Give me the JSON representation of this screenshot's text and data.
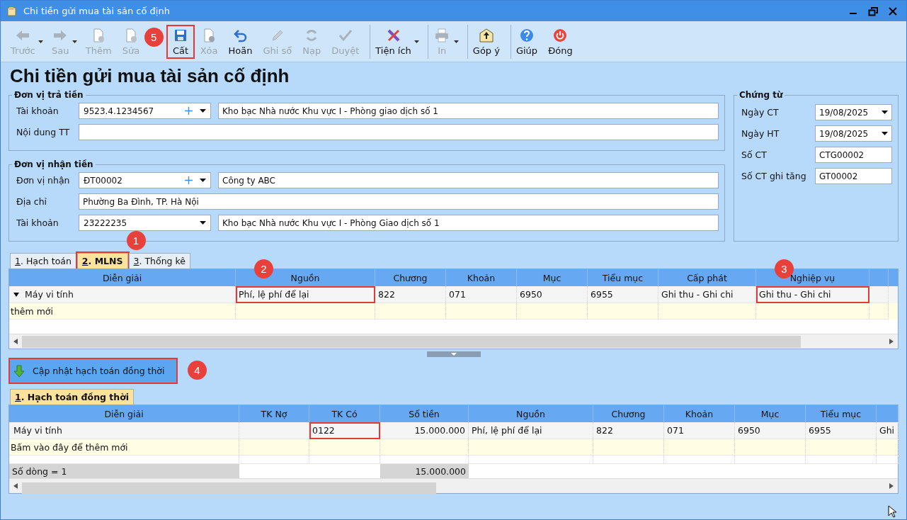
{
  "window": {
    "title": "Chi tiền gửi mua tài sản cố định"
  },
  "toolbar": [
    {
      "label": "Trước",
      "disabled": true,
      "dropdown": true,
      "separator_before": false,
      "highlighted": false
    },
    {
      "label": "Sau",
      "disabled": true,
      "dropdown": true,
      "separator_before": false,
      "highlighted": false
    },
    {
      "label": "Thêm",
      "disabled": true,
      "dropdown": false,
      "separator_before": false,
      "highlighted": false
    },
    {
      "label": "Sửa",
      "disabled": true,
      "dropdown": false,
      "separator_before": false,
      "highlighted": false
    },
    {
      "label": "Cất",
      "disabled": false,
      "dropdown": false,
      "separator_before": false,
      "highlighted": true,
      "callout": "5"
    },
    {
      "label": "Xóa",
      "disabled": true,
      "dropdown": false,
      "separator_before": false,
      "highlighted": false
    },
    {
      "label": "Hoãn",
      "disabled": false,
      "dropdown": false,
      "separator_before": false,
      "highlighted": false
    },
    {
      "label": "Ghi sổ",
      "disabled": true,
      "dropdown": false,
      "separator_before": false,
      "highlighted": false
    },
    {
      "label": "Nạp",
      "disabled": true,
      "dropdown": false,
      "separator_before": false,
      "highlighted": false
    },
    {
      "label": "Duyệt",
      "disabled": true,
      "dropdown": false,
      "separator_before": false,
      "highlighted": false
    },
    {
      "label": "Tiện ích",
      "disabled": false,
      "dropdown": true,
      "separator_before": true,
      "highlighted": false
    },
    {
      "label": "In",
      "disabled": true,
      "dropdown": true,
      "separator_before": true,
      "highlighted": false
    },
    {
      "label": "Góp ý",
      "disabled": false,
      "dropdown": false,
      "separator_before": true,
      "highlighted": false
    },
    {
      "label": "Giúp",
      "disabled": false,
      "dropdown": false,
      "separator_before": true,
      "highlighted": false
    },
    {
      "label": "Đóng",
      "disabled": false,
      "dropdown": false,
      "separator_before": false,
      "highlighted": false
    }
  ],
  "heading": "Chi tiền gửi mua tài sản cố định",
  "payer": {
    "legend": "Đơn vị trả tiền",
    "fields": [
      {
        "label": "Tài khoản",
        "kind": "account",
        "value": "9523.4.1234567",
        "add": true,
        "name": "Kho bạc Nhà nước Khu vực I - Phòng giao dịch số 1"
      },
      {
        "label": "Nội dung TT",
        "kind": "text"
      }
    ]
  },
  "payee": {
    "legend": "Đơn vị nhận tiền",
    "fields": [
      {
        "label": "Đơn vị nhận",
        "kind": "account",
        "value": "ĐT00002",
        "add": true,
        "name": "Công ty ABC"
      },
      {
        "label": "Địa chỉ",
        "kind": "text",
        "value": "Phường Ba Đình, TP. Hà Nội"
      },
      {
        "label": "Tài khoản",
        "kind": "account",
        "value": "23222235",
        "add": false,
        "name": "Kho bạc Nhà nước Khu vực I - Phòng Giao dịch số 1"
      }
    ]
  },
  "voucher": {
    "legend": "Chứng từ",
    "fields": [
      {
        "label": "Ngày CT",
        "kind": "date",
        "value": "19/08/2025"
      },
      {
        "label": "Ngày HT",
        "kind": "date",
        "value": "19/08/2025"
      },
      {
        "label": "Số CT",
        "kind": "text",
        "value": "CTG00002"
      },
      {
        "label": "Số CT ghi tăng",
        "kind": "text",
        "value": "GT00002"
      }
    ]
  },
  "tabs": [
    {
      "hotkey": "1",
      "label": ". Hạch toán",
      "selected": false,
      "highlighted": false
    },
    {
      "hotkey": "2",
      "label": ". MLNS",
      "selected": true,
      "highlighted": true,
      "callout": "1"
    },
    {
      "hotkey": "3",
      "label": ". Thống kê",
      "selected": false,
      "highlighted": false
    }
  ],
  "grid": {
    "columns": [
      {
        "label": "Diễn giải"
      },
      {
        "label": "Nguồn",
        "callout": "2"
      },
      {
        "label": "Chương"
      },
      {
        "label": "Khoản"
      },
      {
        "label": "Mục"
      },
      {
        "label": "Tiểu mục"
      },
      {
        "label": "Cấp phát"
      },
      {
        "label": "Nghiệp vụ",
        "callout": "3"
      },
      {}
    ],
    "rows": [
      {
        "current": true,
        "cells": [
          {
            "text": "Máy vi tính",
            "highlighted": false
          },
          {
            "text": "Phí, lệ phí để lại",
            "highlighted": true
          },
          {
            "text": "822",
            "highlighted": false
          },
          {
            "text": "071",
            "highlighted": false
          },
          {
            "text": "6950",
            "highlighted": false
          },
          {
            "text": "6955",
            "highlighted": false
          },
          {
            "text": "Ghi thu - Ghi chi",
            "highlighted": false
          },
          {
            "text": "Ghi thu - Ghi chi",
            "highlighted": true
          }
        ]
      }
    ],
    "new_row": "thêm mới"
  },
  "update_button": {
    "label": "Cập nhật hạch toán đồng thời",
    "highlighted": true,
    "callout": "4"
  },
  "tabs2": [
    {
      "hotkey": "1",
      "label": ". Hạch toán đồng thời",
      "selected": true
    }
  ],
  "grid2": {
    "columns": [
      {
        "label": "Diễn giải"
      },
      {
        "label": "TK Nợ"
      },
      {
        "label": "TK Có"
      },
      {
        "label": "Số tiền"
      },
      {
        "label": "Nguồn"
      },
      {
        "label": "Chương"
      },
      {
        "label": "Khoản"
      },
      {
        "label": "Mục"
      },
      {
        "label": "Tiểu mục"
      },
      {}
    ],
    "rows": [
      {
        "current": false,
        "cells": [
          {
            "text": "Máy vi tính",
            "highlighted": false
          },
          {
            "highlighted": false
          },
          {
            "text": "0122",
            "highlighted": true
          },
          {
            "text": "15.000.000",
            "highlighted": false
          },
          {
            "text": "Phí, lệ phí để lại",
            "highlighted": false
          },
          {
            "text": "822",
            "highlighted": false
          },
          {
            "text": "071",
            "highlighted": false
          },
          {
            "text": "6950",
            "highlighted": false
          },
          {
            "text": "6955",
            "highlighted": false
          },
          {
            "text": "Ghi",
            "highlighted": false
          }
        ]
      }
    ],
    "new_row": "Bấm vào đây để thêm mới",
    "footer": {
      "count": "Số dòng = 1",
      "total": "15.000.000"
    }
  }
}
